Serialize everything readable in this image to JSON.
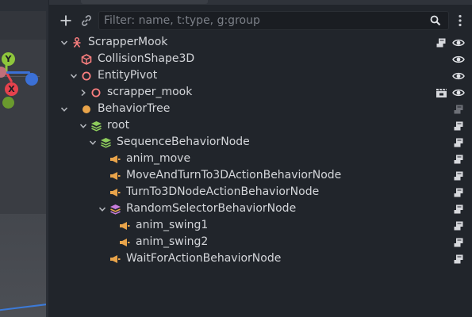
{
  "viewport": {
    "gizmo": {
      "y_axis": "Y",
      "x_axis": "X"
    },
    "colors": {
      "y": "#8ec63c",
      "x": "#e5424d",
      "z": "#3b70d6",
      "z_neg": "#6a9a2e"
    }
  },
  "dock": {
    "filter_placeholder": "Filter: name, t:type, g:group",
    "add_icon": "plus-icon",
    "link_icon": "link-icon",
    "search_icon": "search-icon",
    "menu_icon": "kebab-menu-icon"
  },
  "tree": {
    "nodes": [
      {
        "label": "ScrapperMook",
        "icon": "scene-root-icon",
        "icon_color": "#fc7f7f",
        "arrow": "expanded",
        "right": [
          "script-icon",
          "eye-icon"
        ]
      },
      {
        "label": "CollisionShape3D",
        "icon": "collision-shape-icon",
        "icon_color": "#fc7f7f",
        "arrow": "none",
        "right": [
          "eye-icon"
        ]
      },
      {
        "label": "EntityPivot",
        "icon": "node3d-icon",
        "icon_color": "#fc7f7f",
        "arrow": "expanded",
        "right": [
          "eye-icon"
        ]
      },
      {
        "label": "scrapper_mook",
        "icon": "node3d-icon",
        "icon_color": "#fc7f7f",
        "arrow": "collapsed",
        "right": [
          "clapperboard-icon",
          "eye-icon"
        ]
      },
      {
        "label": "BehaviorTree",
        "icon": "behavior-tree-icon",
        "icon_color": "#e9a44a",
        "arrow": "expanded",
        "right": [
          "script-icon-dim"
        ]
      },
      {
        "label": "root",
        "icon": "layers-icon",
        "icon_color": "#8ecc5c",
        "arrow": "expanded",
        "right": [
          "script-icon"
        ]
      },
      {
        "label": "SequenceBehaviorNode",
        "icon": "layers-icon",
        "icon_color": "#8ecc5c",
        "arrow": "expanded",
        "right": [
          "script-icon"
        ]
      },
      {
        "label": "anim_move",
        "icon": "action-icon",
        "icon_color": "#e9a44a",
        "arrow": "none",
        "right": [
          "script-icon"
        ]
      },
      {
        "label": "MoveAndTurnTo3DActionBehaviorNode",
        "icon": "action-icon",
        "icon_color": "#e9a44a",
        "arrow": "none",
        "right": [
          "script-icon"
        ]
      },
      {
        "label": "TurnTo3DNodeActionBehaviorNode",
        "icon": "action-icon",
        "icon_color": "#e9a44a",
        "arrow": "none",
        "right": [
          "script-icon"
        ]
      },
      {
        "label": "RandomSelectorBehaviorNode",
        "icon": "layers-icon",
        "icon_color": "#c77ddb",
        "arrow": "expanded",
        "right": [
          "script-icon"
        ]
      },
      {
        "label": "anim_swing1",
        "icon": "action-icon",
        "icon_color": "#e9a44a",
        "arrow": "none",
        "right": [
          "script-icon"
        ]
      },
      {
        "label": "anim_swing2",
        "icon": "action-icon",
        "icon_color": "#e9a44a",
        "arrow": "none",
        "right": [
          "script-icon"
        ]
      },
      {
        "label": "WaitForActionBehaviorNode",
        "icon": "action-icon",
        "icon_color": "#e9a44a",
        "arrow": "none",
        "right": [
          "script-icon"
        ]
      }
    ]
  }
}
